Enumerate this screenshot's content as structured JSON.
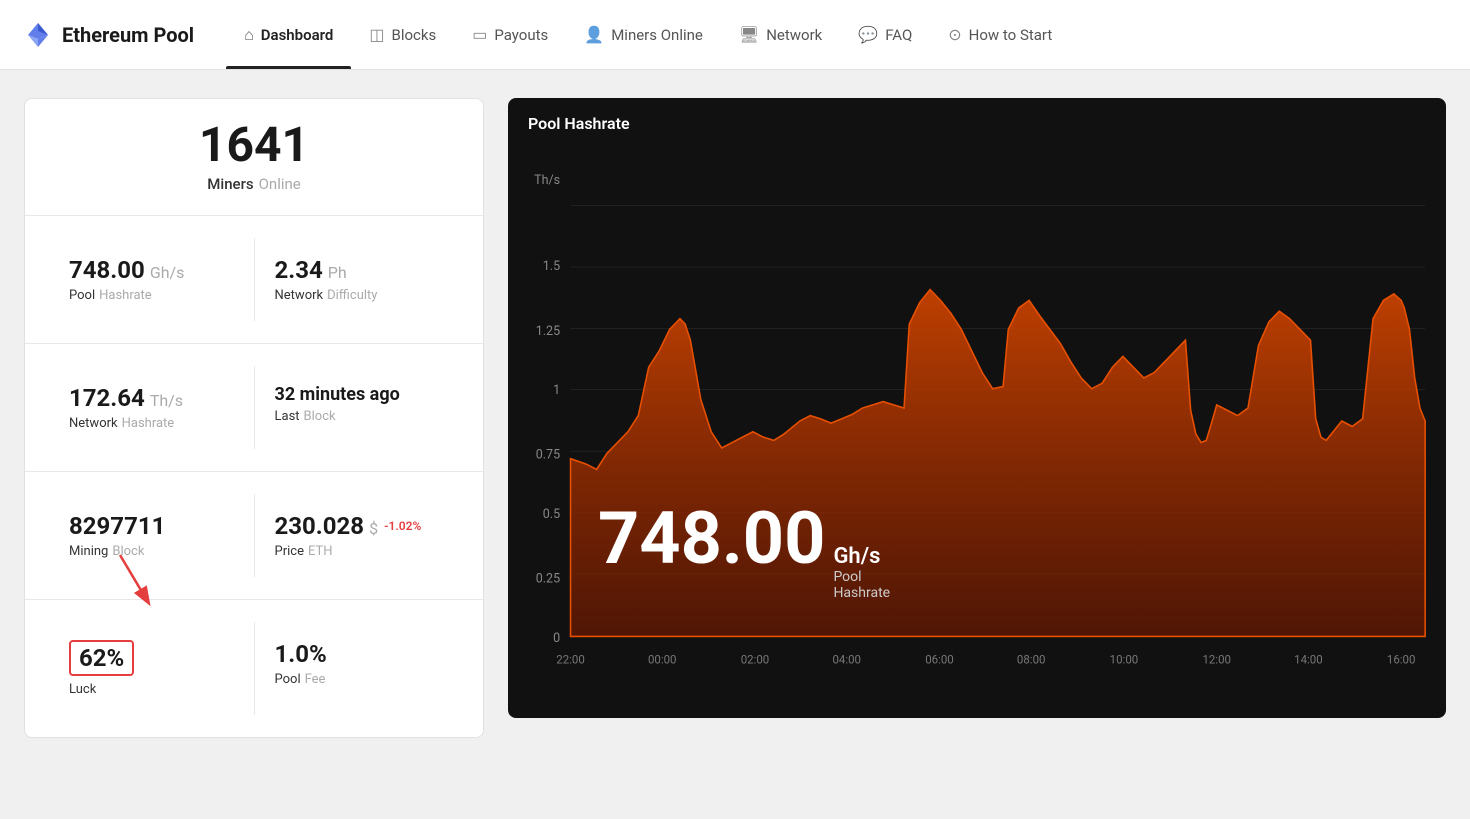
{
  "header": {
    "logo_title": "Ethereum Pool",
    "nav_items": [
      {
        "id": "dashboard",
        "label": "Dashboard",
        "icon": "🏠",
        "active": true
      },
      {
        "id": "blocks",
        "label": "Blocks",
        "icon": "⬡",
        "active": false
      },
      {
        "id": "payouts",
        "label": "Payouts",
        "icon": "🗂",
        "active": false
      },
      {
        "id": "miners-online",
        "label": "Miners Online",
        "icon": "👥",
        "active": false
      },
      {
        "id": "network",
        "label": "Network",
        "icon": "🖥",
        "active": false
      },
      {
        "id": "faq",
        "label": "FAQ",
        "icon": "💬",
        "active": false
      },
      {
        "id": "how-to-start",
        "label": "How to Start",
        "icon": "?",
        "active": false
      }
    ]
  },
  "stats": {
    "miners_online_value": "1641",
    "miners_label": "Miners",
    "online_label": "Online",
    "pool_hashrate_value": "748.00",
    "pool_hashrate_unit": "Gh/s",
    "pool_label": "Pool",
    "hashrate_label": "Hashrate",
    "network_difficulty_value": "2.34",
    "network_difficulty_unit": "Ph",
    "network_label": "Network",
    "difficulty_label": "Difficulty",
    "network_hashrate_value": "172.64",
    "network_hashrate_unit": "Th/s",
    "network_hashrate_label": "Network",
    "hashrate_label2": "Hashrate",
    "last_block_value": "32 minutes ago",
    "last_label": "Last",
    "block_label": "Block",
    "mining_block_value": "8297711",
    "mining_label": "Mining",
    "block_label2": "Block",
    "price_value": "230.028",
    "price_unit": "$",
    "price_change": "-1.02%",
    "price_label": "Price",
    "eth_label": "ETH",
    "luck_value": "62%",
    "luck_label": "Luck",
    "pool_fee_value": "1.0%",
    "pool_fee_label": "Pool",
    "fee_label": "Fee"
  },
  "chart": {
    "title": "Pool Hashrate",
    "y_unit": "Th/s",
    "y_labels": [
      "0",
      "0.25",
      "0.5",
      "0.75",
      "1",
      "1.25",
      "1.5"
    ],
    "x_labels": [
      "22:00",
      "00:00",
      "02:00",
      "04:00",
      "06:00",
      "08:00",
      "10:00",
      "12:00",
      "14:00",
      "16:00"
    ],
    "overlay_value": "748.00",
    "overlay_unit": "Gh/s",
    "overlay_label1": "Pool",
    "overlay_label2": "Hashrate"
  }
}
